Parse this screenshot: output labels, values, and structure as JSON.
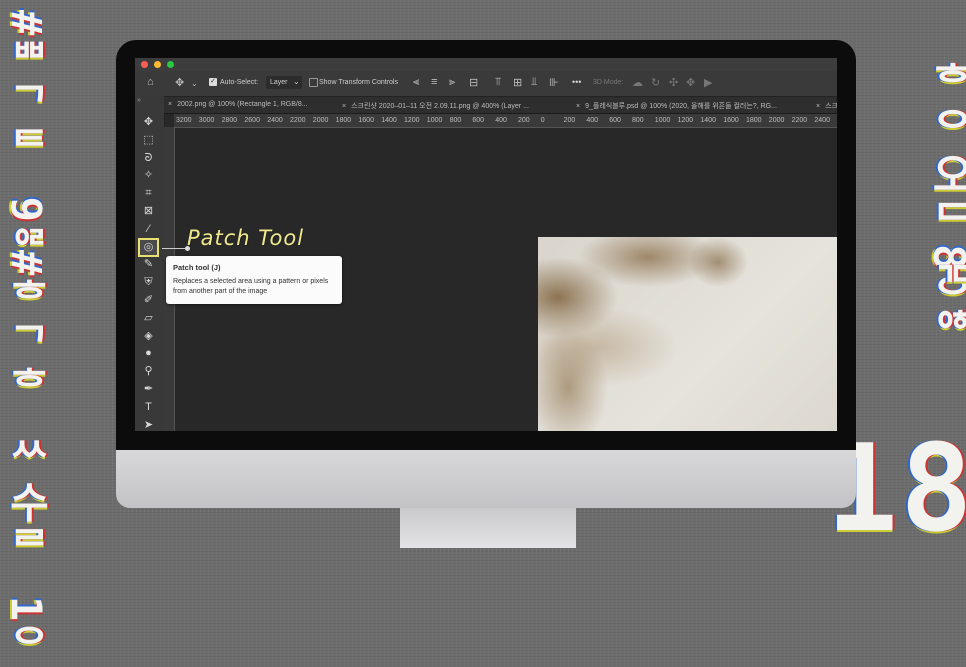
{
  "decorations": {
    "left_top": "#ᄈᄀᄐ 9ᄋᄅ",
    "left_bottom": "#ᄒᄀᄒ ᄊ수ᄅ 1ᄋ",
    "right_top": "ᄒᄋ오ᄃ8ᄋ",
    "right_bottom": "ᄀᄃᄋᄒ",
    "big_number": "18"
  },
  "window": {
    "traffic_lights": {
      "close": "#fd5f57",
      "minimize": "#febc2e",
      "zoom": "#28c840"
    }
  },
  "options_bar": {
    "home_icon": "home-icon",
    "move_icon": "move-icon",
    "auto_select_checked": true,
    "auto_select_label": "Auto-Select:",
    "auto_select_value": "Layer",
    "show_transform_label": "Show Transform Controls",
    "show_transform_checked": false,
    "more_label": "•••",
    "mode_label": "3D Mode:"
  },
  "tabs": [
    {
      "close": "×",
      "label": "2002.png @ 100% (Rectangle 1, RGB/8..."
    },
    {
      "close": "×",
      "label": "스크린샷 2020–01–11 오전 2.09.11.png @ 400% (Layer ..."
    },
    {
      "close": "×",
      "label": "9_플레식블루.psd @ 100% (2020, 올해를 위흔들 컬러는?, RG..."
    },
    {
      "close": "×",
      "label": "스크린"
    }
  ],
  "ruler_h": [
    "3200",
    "3000",
    "2800",
    "2600",
    "2400",
    "2200",
    "2000",
    "1800",
    "1600",
    "1400",
    "1200",
    "1000",
    "800",
    "600",
    "400",
    "200",
    "0",
    "200",
    "400",
    "600",
    "800",
    "1000",
    "1200",
    "1400",
    "1600",
    "1800",
    "2000",
    "2200",
    "2400"
  ],
  "toolbar": {
    "collapse": "»",
    "tools": [
      {
        "name": "move-tool",
        "glyph": "✥"
      },
      {
        "name": "marquee-tool",
        "glyph": "⬚"
      },
      {
        "name": "lasso-tool",
        "glyph": "ᘐ"
      },
      {
        "name": "magic-wand-tool",
        "glyph": "✧"
      },
      {
        "name": "crop-tool",
        "glyph": "⌗"
      },
      {
        "name": "frame-tool",
        "glyph": "⊠"
      },
      {
        "name": "eyedropper-tool",
        "glyph": "⁄"
      },
      {
        "name": "patch-tool",
        "glyph": "◎"
      },
      {
        "name": "brush-tool",
        "glyph": "✎"
      },
      {
        "name": "stamp-tool",
        "glyph": "⛨"
      },
      {
        "name": "history-brush-tool",
        "glyph": "✐"
      },
      {
        "name": "eraser-tool",
        "glyph": "▱"
      },
      {
        "name": "paint-bucket-tool",
        "glyph": "◈"
      },
      {
        "name": "blur-tool",
        "glyph": "●"
      },
      {
        "name": "dodge-tool",
        "glyph": "⚲"
      },
      {
        "name": "pen-tool",
        "glyph": "✒"
      },
      {
        "name": "type-tool",
        "glyph": "T"
      },
      {
        "name": "path-select-tool",
        "glyph": "➤"
      }
    ]
  },
  "callout": {
    "label": "Patch Tool"
  },
  "tooltip": {
    "title": "Patch tool (J)",
    "description": "Replaces a selected area using a pattern or pixels from another part of the image"
  }
}
